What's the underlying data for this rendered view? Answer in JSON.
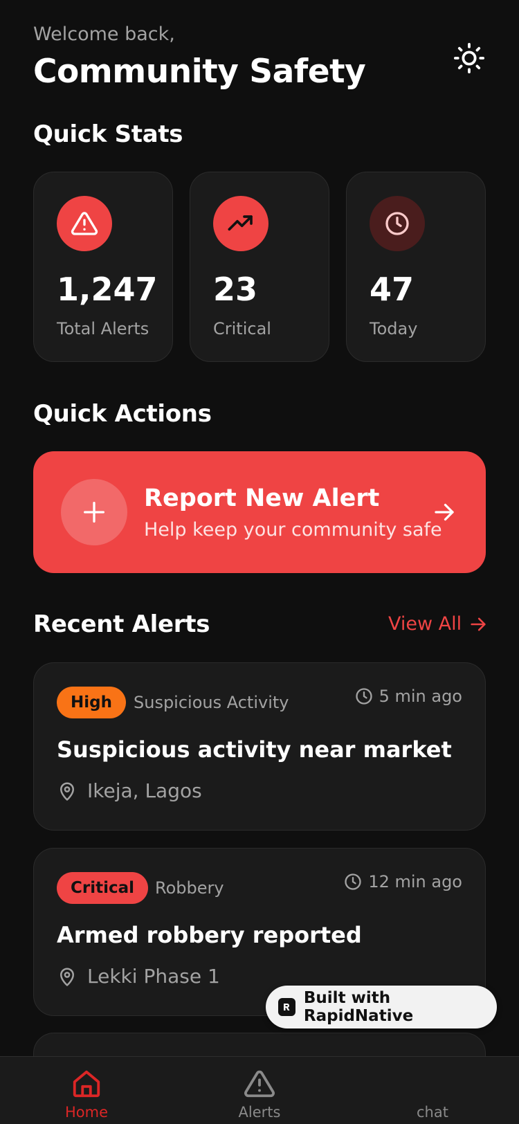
{
  "header": {
    "welcome": "Welcome back,",
    "title": "Community Safety",
    "theme_icon": "sun-icon"
  },
  "quick_stats": {
    "title": "Quick Stats",
    "items": [
      {
        "value": "1,247",
        "label": "Total Alerts",
        "icon": "alert-triangle-icon",
        "icon_bg": "#ef4444"
      },
      {
        "value": "23",
        "label": "Critical",
        "icon": "trending-up-icon",
        "icon_bg": "#ef4444"
      },
      {
        "value": "47",
        "label": "Today",
        "icon": "clock-icon",
        "icon_bg": "#4a1d1d"
      }
    ]
  },
  "quick_actions": {
    "title": "Quick Actions",
    "report": {
      "title": "Report New Alert",
      "subtitle": "Help keep your community safe"
    }
  },
  "recent_alerts": {
    "title": "Recent Alerts",
    "view_all": "View All",
    "items": [
      {
        "severity": "High",
        "severity_color": "#f97316",
        "category": "Suspicious Activity",
        "time": "5 min ago",
        "title": "Suspicious activity near market",
        "location": "Ikeja, Lagos"
      },
      {
        "severity": "Critical",
        "severity_color": "#ef4444",
        "category": "Robbery",
        "time": "12 min ago",
        "title": "Armed robbery reported",
        "location": "Lekki Phase 1"
      }
    ]
  },
  "built_with": "Built with RapidNative",
  "tabs": [
    {
      "label": "Home",
      "icon": "home-icon",
      "active": true
    },
    {
      "label": "Alerts",
      "icon": "alert-triangle-icon",
      "active": false
    },
    {
      "label": "chat",
      "icon": "chat-icon",
      "active": false
    }
  ],
  "colors": {
    "accent": "#ef4444",
    "background": "#0f0f0f",
    "card": "#1b1b1b",
    "muted": "#a3a3a3",
    "high": "#f97316"
  }
}
